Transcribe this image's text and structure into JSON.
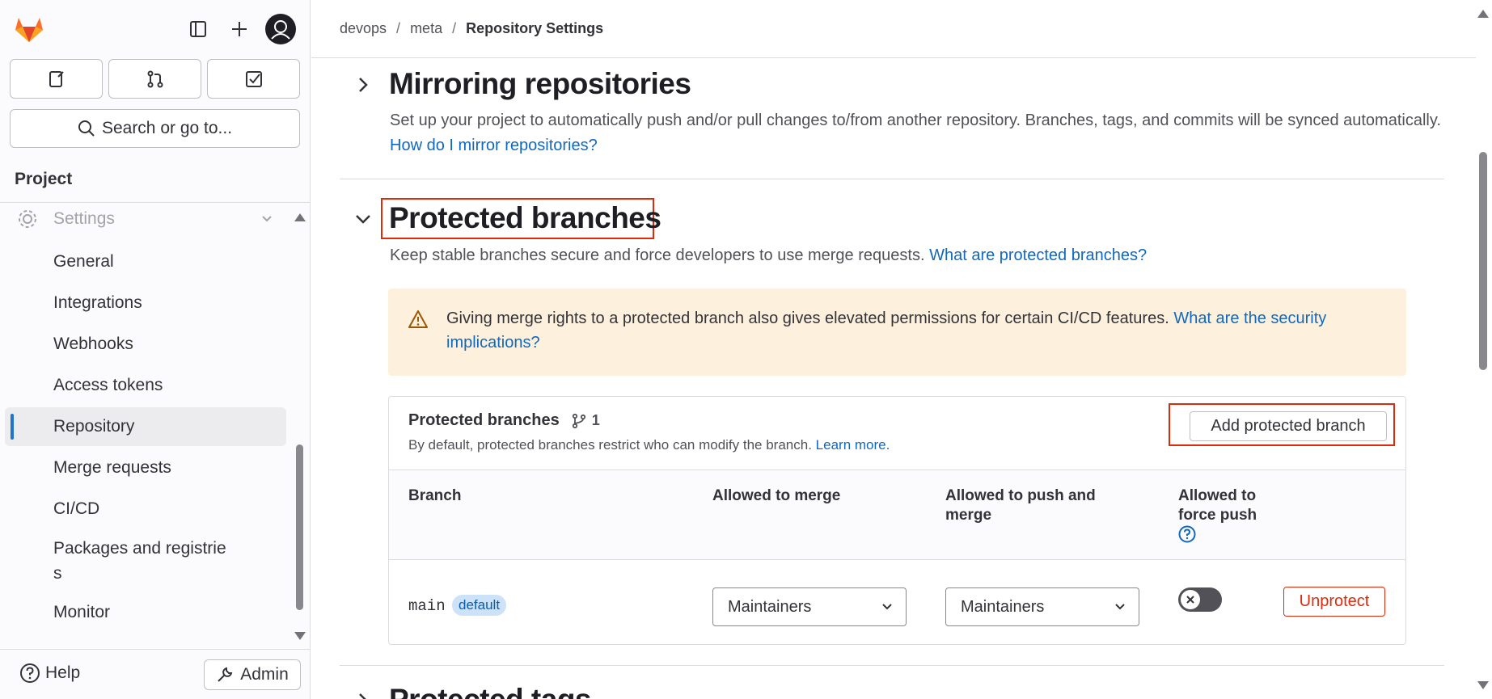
{
  "sidebar": {
    "search_label": "Search or go to...",
    "section_title": "Project",
    "settings_label": "Settings",
    "items": [
      {
        "label": "General"
      },
      {
        "label": "Integrations"
      },
      {
        "label": "Webhooks"
      },
      {
        "label": "Access tokens"
      },
      {
        "label": "Repository",
        "active": true
      },
      {
        "label": "Merge requests"
      },
      {
        "label": "CI/CD"
      },
      {
        "label": "Packages and registrie",
        "label_cont": "s"
      },
      {
        "label": "Monitor"
      }
    ],
    "help_label": "Help",
    "admin_label": "Admin"
  },
  "breadcrumb": [
    "devops",
    "meta",
    "Repository Settings"
  ],
  "mirroring": {
    "title": "Mirroring repositories",
    "desc": "Set up your project to automatically push and/or pull changes to/from another repository. Branches, tags, and commits will be synced automatically.",
    "link": "How do I mirror repositories?"
  },
  "protected": {
    "title": "Protected branches",
    "desc": "Keep stable branches secure and force developers to use merge requests.",
    "link": "What are protected branches?",
    "alert_text": "Giving merge rights to a protected branch also gives elevated permissions for certain CI/CD features.",
    "alert_link": "What are the security implications?",
    "card_title": "Protected branches",
    "count": "1",
    "card_sub": "By default, protected branches restrict who can modify the branch.",
    "card_sub_link": "Learn more.",
    "add_button": "Add protected branch",
    "headers": {
      "branch": "Branch",
      "merge": "Allowed to merge",
      "push": "Allowed to push and merge",
      "force": "Allowed to force push"
    },
    "row": {
      "branch": "main",
      "badge": "default",
      "merge": "Maintainers",
      "push": "Maintainers",
      "unprotect": "Unprotect"
    }
  },
  "next_section_title": "Protected tags",
  "colors": {
    "link": "#1068bf",
    "danger": "#dd2b0e",
    "warning_bg": "#fdf1dd"
  }
}
